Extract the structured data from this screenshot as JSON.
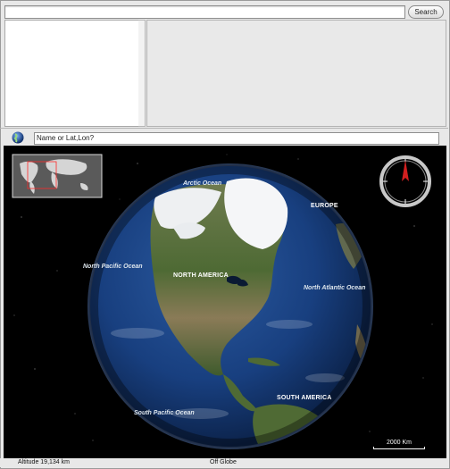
{
  "search": {
    "button_label": "Search",
    "value": ""
  },
  "location": {
    "placeholder": "Name or Lat,Lon?"
  },
  "map_labels": {
    "arctic_ocean": "Arctic Ocean",
    "europe": "EUROPE",
    "north_pacific": "North Pacific Ocean",
    "north_america": "NORTH AMERICA",
    "north_atlantic": "North Atlantic Ocean",
    "south_america": "SOUTH AMERICA",
    "south_pacific": "South Pacific Ocean"
  },
  "scale": {
    "label": "2000 Km"
  },
  "status": {
    "altitude": "Altitude  19,134 km",
    "globe_state": "Off Globe"
  },
  "colors": {
    "background": "#000000",
    "ocean": "#1d3f78",
    "land_green": "#4f6a34",
    "land_tan": "#8c7a55",
    "ice": "#f5f6f8",
    "compass_needle": "#d21f1f"
  },
  "icons": {
    "world_wind_globe": "globe-icon",
    "compass": "compass-icon",
    "world_map": "world-map-icon"
  }
}
